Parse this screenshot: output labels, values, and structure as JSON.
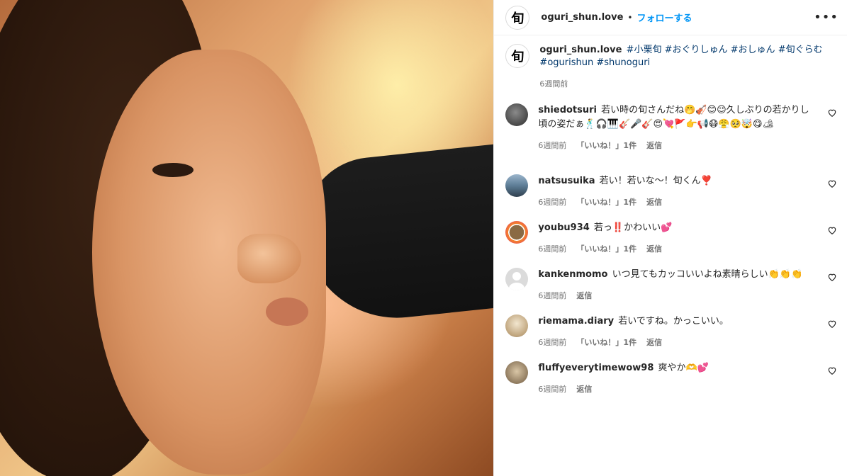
{
  "header": {
    "logo_char": "旬",
    "username": "oguri_shun.love",
    "dot": "•",
    "follow_label": "フォローする",
    "more_label": "•••"
  },
  "caption": {
    "logo_char": "旬",
    "username": "oguri_shun.love",
    "tags": [
      "#小栗旬",
      "#おぐりしゅん",
      "#おしゅん",
      "#旬ぐらむ",
      "#ogurishun",
      "#shunoguri"
    ],
    "time": "6週間前"
  },
  "comments": [
    {
      "username": "shiedotsuri",
      "text": "若い時の旬さんだね🤭🎻😊😉久しぶりの若かりし頃の姿だぁ🕺🎧🎹🎸🎤🎸😍💘🚩👉📢😷😤🥺🤯😋🏕",
      "time": "6週間前",
      "likes": "「いいね！」1件",
      "reply": "返信"
    },
    {
      "username": "natsusuika",
      "text": "若い！若いな〜！旬くん❣️",
      "time": "6週間前",
      "likes": "「いいね！」1件",
      "reply": "返信"
    },
    {
      "username": "youbu934",
      "text": "若っ‼️かわいい💕",
      "time": "6週間前",
      "likes": "「いいね！」1件",
      "reply": "返信"
    },
    {
      "username": "kankenmomo",
      "text": "いつ見てもカッコいいよね素晴らしい👏👏👏",
      "time": "6週間前",
      "reply": "返信"
    },
    {
      "username": "riemama.diary",
      "text": "若いですね。かっこいい。",
      "time": "6週間前",
      "likes": "「いいね！」1件",
      "reply": "返信"
    },
    {
      "username": "fluffyeverytimewow98",
      "text": "爽やか🫶💕",
      "time": "6週間前",
      "reply": "返信"
    }
  ]
}
